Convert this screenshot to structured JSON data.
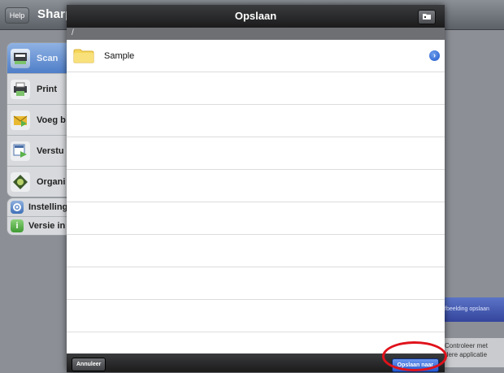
{
  "app": {
    "help_label": "Help",
    "title": "Sharp"
  },
  "sidebar": {
    "main_items": [
      {
        "label": "Scan",
        "icon": "scan-icon",
        "active": true
      },
      {
        "label": "Print",
        "icon": "print-icon",
        "active": false
      },
      {
        "label": "Voeg b",
        "icon": "attach-icon",
        "active": false
      },
      {
        "label": "Verstu",
        "icon": "send-icon",
        "active": false
      },
      {
        "label": "Organi",
        "icon": "organize-icon",
        "active": false
      }
    ],
    "secondary_items": [
      {
        "label": "Instelling",
        "icon": "gear-icon"
      },
      {
        "label": "Versie in",
        "icon": "info-icon"
      }
    ]
  },
  "right_panel": {
    "save_image_label": "fbeelding opslaan",
    "open_in_app_line1": "Controleer met",
    "open_in_app_line2": "dere applicatie"
  },
  "dialog": {
    "title": "Opslaan",
    "path": "/",
    "items": [
      {
        "name": "Sample",
        "type": "folder"
      }
    ],
    "cancel_label": "Annuleer",
    "save_label": "Opslaan naar"
  },
  "colors": {
    "accent_blue": "#2559cf",
    "highlight_red": "#e0121b",
    "folder_yellow": "#f5d65a"
  }
}
